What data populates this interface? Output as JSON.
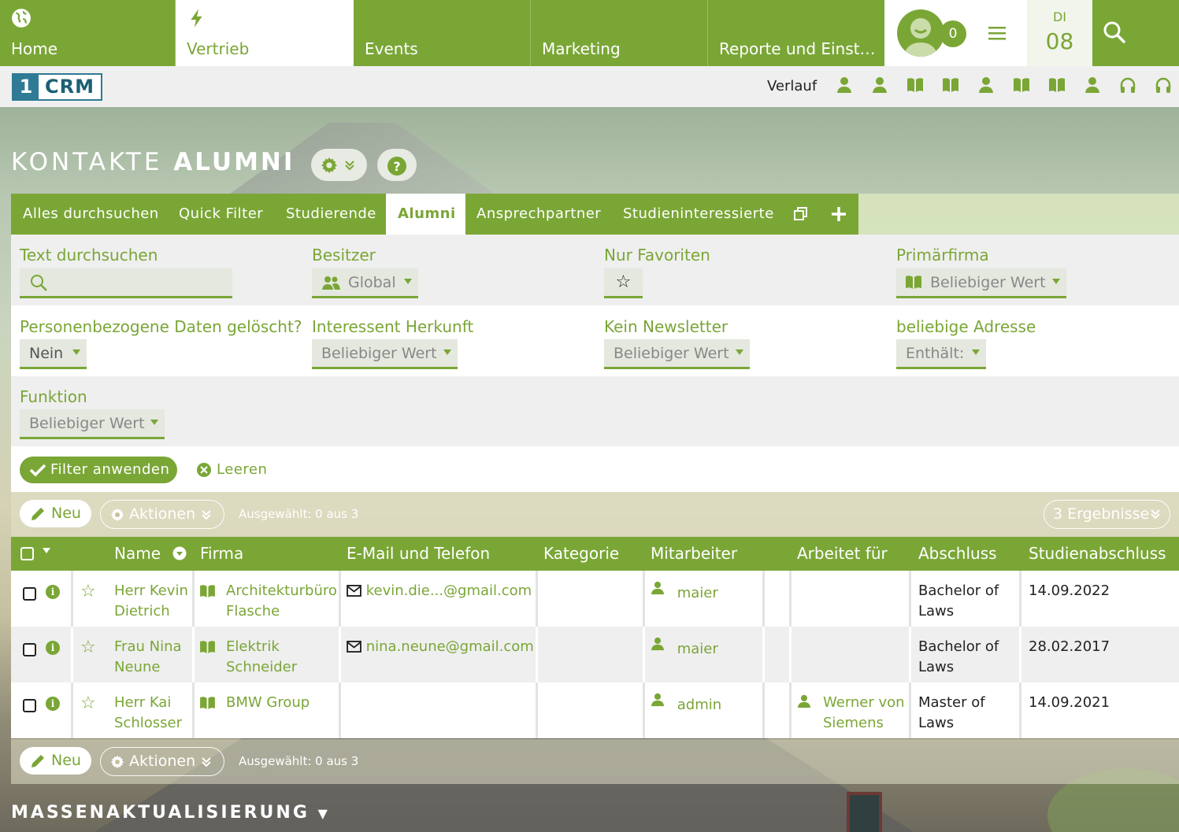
{
  "nav": {
    "tabs": [
      {
        "label": "Home",
        "icon": "globe-icon"
      },
      {
        "label": "Vertrieb",
        "icon": "bolt-icon",
        "active": true
      },
      {
        "label": "Events"
      },
      {
        "label": "Marketing"
      },
      {
        "label": "Reporte und Einst…"
      }
    ],
    "notification_count": "0",
    "date_day": "DI",
    "date_num": "08"
  },
  "secbar": {
    "logo_num": "1",
    "logo_text": "CRM",
    "history_label": "Verlauf",
    "history_icons": [
      "person-icon",
      "person-icon",
      "book-icon",
      "book-icon",
      "person-icon",
      "book-icon",
      "book-icon",
      "person-icon",
      "headset-icon",
      "headset-icon"
    ]
  },
  "page": {
    "title_light": "KONTAKTE",
    "title_bold": "ALUMNI"
  },
  "filter_tabs": [
    "Alles durchsuchen",
    "Quick Filter",
    "Studierende",
    "Alumni",
    "Ansprechpartner",
    "Studieninteressierte"
  ],
  "active_filter_tab": "Alumni",
  "filters": {
    "text_search": {
      "label": "Text durchsuchen",
      "value": ""
    },
    "owner": {
      "label": "Besitzer",
      "value": "Global"
    },
    "favorites": {
      "label": "Nur Favoriten"
    },
    "primary_company": {
      "label": "Primärfirma",
      "value": "Beliebiger Wert"
    },
    "personal_data_deleted": {
      "label": "Personenbezogene Daten gelöscht?",
      "value": "Nein"
    },
    "lead_source": {
      "label": "Interessent Herkunft",
      "value": "Beliebiger Wert"
    },
    "no_newsletter": {
      "label": "Kein Newsletter",
      "value": "Beliebiger Wert"
    },
    "any_address": {
      "label": "beliebige Adresse",
      "value": "Enthält:"
    },
    "function": {
      "label": "Funktion",
      "value": "Beliebiger Wert"
    },
    "apply_label": "Filter anwenden",
    "clear_label": "Leeren"
  },
  "toolbar": {
    "new_label": "Neu",
    "actions_label": "Aktionen",
    "selected_info": "Ausgewählt: 0 aus 3",
    "results_label": "3 Ergebnisse"
  },
  "table": {
    "columns": [
      "Name",
      "Firma",
      "E-Mail und Telefon",
      "Kategorie",
      "Mitarbeiter",
      "Arbeitet für",
      "Abschluss",
      "Studienabschluss"
    ],
    "rows": [
      {
        "name_line1": "Herr Kevin",
        "name_line2": "Dietrich",
        "company_line1": "Architekturbüro",
        "company_line2": "Flasche",
        "email": "kevin.die...@gmail.com",
        "category": "",
        "employee": "maier",
        "works_for_line1": "",
        "works_for_line2": "",
        "degree_line1": "Bachelor of",
        "degree_line2": "Laws",
        "graduation": "14.09.2022"
      },
      {
        "name_line1": "Frau Nina",
        "name_line2": "Neune",
        "company_line1": "Elektrik",
        "company_line2": "Schneider",
        "email": "nina.neune@gmail.com",
        "category": "",
        "employee": "maier",
        "works_for_line1": "",
        "works_for_line2": "",
        "degree_line1": "Bachelor of",
        "degree_line2": "Laws",
        "graduation": "28.02.2017"
      },
      {
        "name_line1": "Herr Kai",
        "name_line2": "Schlosser",
        "company_line1": "BMW Group",
        "company_line2": "",
        "email": "",
        "category": "",
        "employee": "admin",
        "works_for_line1": "Werner von",
        "works_for_line2": "Siemens",
        "degree_line1": "Master of",
        "degree_line2": "Laws",
        "graduation": "14.09.2021"
      }
    ]
  },
  "mass_update_label": "MASSENAKTUALISIERUNG",
  "colors": {
    "accent": "#7aa636",
    "logo": "#2f7a94"
  }
}
